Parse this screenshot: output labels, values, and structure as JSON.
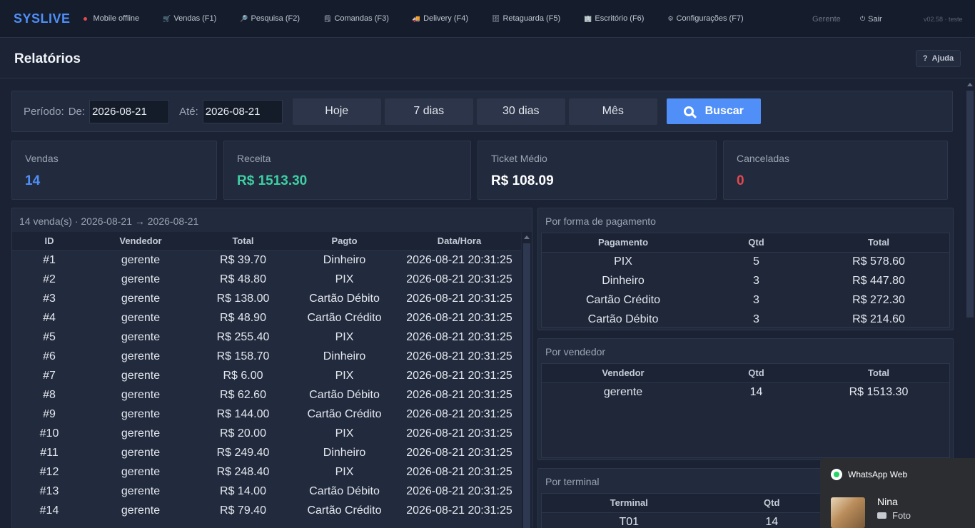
{
  "topbar": {
    "logo": "SYSLIVE",
    "status": "Mobile offline",
    "nav": [
      {
        "label": "Vendas (F1)",
        "icon": "cart-icon",
        "glyph": "🛒"
      },
      {
        "label": "Pesquisa (F2)",
        "icon": "search-icon",
        "glyph": "🔎"
      },
      {
        "label": "Comandas (F3)",
        "icon": "receipt-icon",
        "glyph": "🗒"
      },
      {
        "label": "Delivery (F4)",
        "icon": "truck-icon",
        "glyph": "🚚"
      },
      {
        "label": "Retaguarda (F5)",
        "icon": "box-icon",
        "glyph": "🗄"
      },
      {
        "label": "Escritório (F6)",
        "icon": "building-icon",
        "glyph": "🏢"
      },
      {
        "label": "Configurações (F7)",
        "icon": "gear-icon",
        "glyph": "⚙"
      }
    ],
    "user": "Gerente",
    "logout": "Sair",
    "version": "v02.58 · teste"
  },
  "header": {
    "title": "Relatórios",
    "help": "Ajuda"
  },
  "filter": {
    "periodo_label": "Período:",
    "de_label": "De:",
    "de_value": "2026-08-21",
    "ate_label": "Até:",
    "ate_value": "2026-08-21",
    "quick": [
      "Hoje",
      "7 dias",
      "30 dias",
      "Mês"
    ],
    "buscar": "Buscar"
  },
  "stats": {
    "vendas": {
      "label": "Vendas",
      "value": "14",
      "color": "#4f8ff7"
    },
    "receita": {
      "label": "Receita",
      "value": "R$ 1513.30",
      "color": "#3ecfa3"
    },
    "ticket": {
      "label": "Ticket Médio",
      "value": "R$ 108.09",
      "color": "#ffffff"
    },
    "canceladas": {
      "label": "Canceladas",
      "value": "0",
      "color": "#e5484d"
    }
  },
  "sales": {
    "summary": "14 venda(s)  ·  2026-08-21 → 2026-08-21",
    "headers": [
      "ID",
      "Vendedor",
      "Total",
      "Pagto",
      "Data/Hora"
    ],
    "rows": [
      [
        "#1",
        "gerente",
        "R$ 39.70",
        "Dinheiro",
        "2026-08-21 20:31:25"
      ],
      [
        "#2",
        "gerente",
        "R$ 48.80",
        "PIX",
        "2026-08-21 20:31:25"
      ],
      [
        "#3",
        "gerente",
        "R$ 138.00",
        "Cartão Débito",
        "2026-08-21 20:31:25"
      ],
      [
        "#4",
        "gerente",
        "R$ 48.90",
        "Cartão Crédito",
        "2026-08-21 20:31:25"
      ],
      [
        "#5",
        "gerente",
        "R$ 255.40",
        "PIX",
        "2026-08-21 20:31:25"
      ],
      [
        "#6",
        "gerente",
        "R$ 158.70",
        "Dinheiro",
        "2026-08-21 20:31:25"
      ],
      [
        "#7",
        "gerente",
        "R$ 6.00",
        "PIX",
        "2026-08-21 20:31:25"
      ],
      [
        "#8",
        "gerente",
        "R$ 62.60",
        "Cartão Débito",
        "2026-08-21 20:31:25"
      ],
      [
        "#9",
        "gerente",
        "R$ 144.00",
        "Cartão Crédito",
        "2026-08-21 20:31:25"
      ],
      [
        "#10",
        "gerente",
        "R$ 20.00",
        "PIX",
        "2026-08-21 20:31:25"
      ],
      [
        "#11",
        "gerente",
        "R$ 249.40",
        "Dinheiro",
        "2026-08-21 20:31:25"
      ],
      [
        "#12",
        "gerente",
        "R$ 248.40",
        "PIX",
        "2026-08-21 20:31:25"
      ],
      [
        "#13",
        "gerente",
        "R$ 14.00",
        "Cartão Débito",
        "2026-08-21 20:31:25"
      ],
      [
        "#14",
        "gerente",
        "R$ 79.40",
        "Cartão Crédito",
        "2026-08-21 20:31:25"
      ]
    ]
  },
  "payment": {
    "title": "Por forma de pagamento",
    "headers": [
      "Pagamento",
      "Qtd",
      "Total"
    ],
    "rows": [
      [
        "PIX",
        "5",
        "R$ 578.60"
      ],
      [
        "Dinheiro",
        "3",
        "R$ 447.80"
      ],
      [
        "Cartão Crédito",
        "3",
        "R$ 272.30"
      ],
      [
        "Cartão Débito",
        "3",
        "R$ 214.60"
      ]
    ]
  },
  "seller": {
    "title": "Por vendedor",
    "headers": [
      "Vendedor",
      "Qtd",
      "Total"
    ],
    "rows": [
      [
        "gerente",
        "14",
        "R$ 1513.30"
      ]
    ]
  },
  "terminal": {
    "title": "Por terminal",
    "headers": [
      "Terminal",
      "Qtd"
    ],
    "rows": [
      [
        "T01",
        "14"
      ]
    ]
  },
  "notification": {
    "app": "WhatsApp Web",
    "sender": "Nina",
    "message": "Foto"
  }
}
